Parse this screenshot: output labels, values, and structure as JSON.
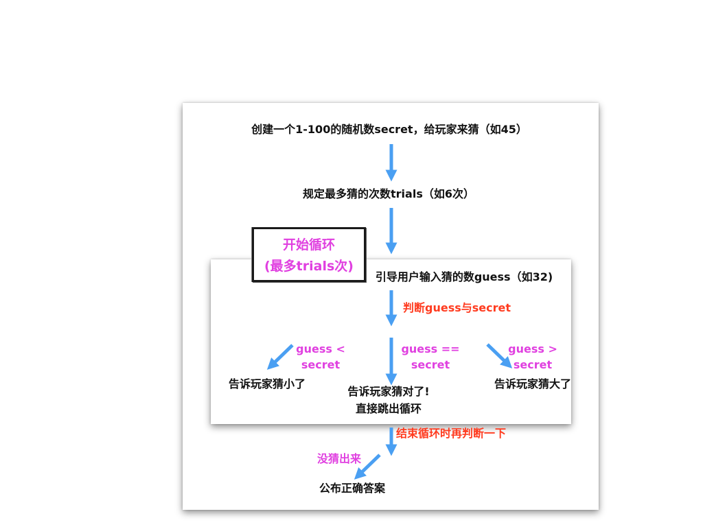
{
  "steps": {
    "create_secret": "创建一个1-100的随机数secret，给玩家来猜（如45）",
    "set_trials": "规定最多猜的次数trials（如6次）",
    "prompt_guess": "引导用户输入猜的数guess（如32)",
    "reveal_answer": "公布正确答案"
  },
  "loop_label": {
    "line1": "开始循环",
    "line2": "(最多trials次)"
  },
  "conditions": {
    "judge": "判断guess与secret",
    "less": "guess <\nsecret",
    "equal": "guess ==\nsecret",
    "greater": "guess >\nsecret",
    "after_loop": "结束循环时再判断一下",
    "not_guessed": "没猜出来"
  },
  "outcomes": {
    "too_small": "告诉玩家猜小了",
    "correct": "告诉玩家猜对了!\n直接跳出循环",
    "too_big": "告诉玩家猜大了"
  },
  "colors": {
    "arrow": "#4a9ff2",
    "condition_pink": "#e040e0",
    "condition_red": "#ff3b1f",
    "text": "#111111"
  }
}
